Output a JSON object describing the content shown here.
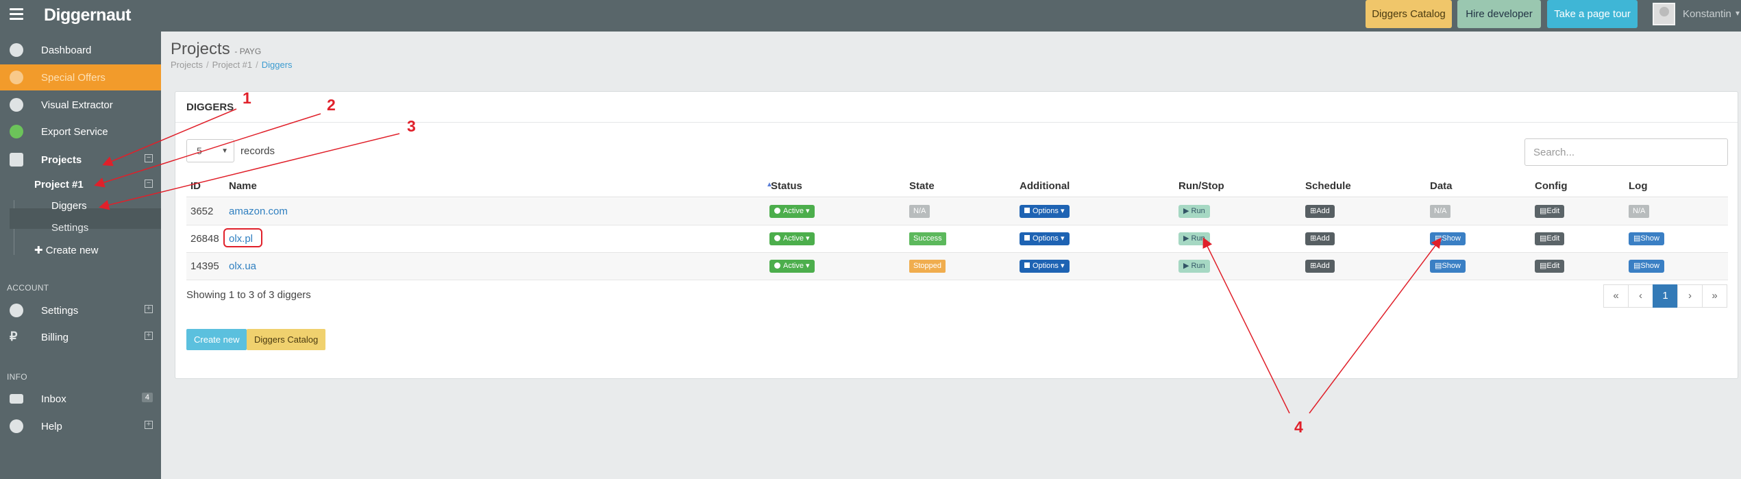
{
  "app": {
    "name": "Diggernaut"
  },
  "topbar": {
    "catalog_label": "Diggers Catalog",
    "hire_label": "Hire developer",
    "tour_label": "Take a page tour",
    "user_name": "Konstantin"
  },
  "sidebar": {
    "items": [
      {
        "label": "Dashboard",
        "icon": "dashboard-icon"
      },
      {
        "label": "Special Offers",
        "icon": "diamond-icon"
      },
      {
        "label": "Visual Extractor",
        "icon": "chrome-icon"
      },
      {
        "label": "Export Service",
        "icon": "cloud-upload-icon"
      },
      {
        "label": "Projects",
        "icon": "briefcase-icon"
      }
    ],
    "project": "Project #1",
    "sub_diggers": "Diggers",
    "sub_settings": "Settings",
    "create_new": "Create new",
    "account_header": "ACCOUNT",
    "account_items": [
      {
        "label": "Settings",
        "icon": "gears-icon"
      },
      {
        "label": "Billing",
        "icon": "ruble-icon"
      }
    ],
    "info_header": "INFO",
    "info_items": [
      {
        "label": "Inbox",
        "icon": "inbox-icon",
        "badge": "4"
      },
      {
        "label": "Help",
        "icon": "question-icon"
      }
    ]
  },
  "header": {
    "title": "Projects",
    "subtitle": "- PAYG",
    "breadcrumb": [
      "Projects",
      "Project #1",
      "Diggers"
    ]
  },
  "panel": {
    "title": "DIGGERS",
    "records_value": "5",
    "records_label": "records",
    "search_placeholder": "Search..."
  },
  "table": {
    "columns": [
      "ID",
      "Name",
      "Status",
      "State",
      "Additional",
      "Run/Stop",
      "Schedule",
      "Data",
      "Config",
      "Log"
    ],
    "rows": [
      {
        "id": "3652",
        "name": "amazon.com",
        "status": "Active",
        "state": "N/A",
        "additional": "Options",
        "run": "Run",
        "schedule": "Add",
        "data": "N/A",
        "config": "Edit",
        "log": "N/A"
      },
      {
        "id": "26848",
        "name": "olx.pl",
        "status": "Active",
        "state": "Success",
        "additional": "Options",
        "run": "Run",
        "schedule": "Add",
        "data": "Show",
        "config": "Edit",
        "log": "Show"
      },
      {
        "id": "14395",
        "name": "olx.ua",
        "status": "Active",
        "state": "Stopped",
        "additional": "Options",
        "run": "Run",
        "schedule": "Add",
        "data": "Show",
        "config": "Edit",
        "log": "Show"
      }
    ]
  },
  "footer": {
    "showing": "Showing 1 to 3 of 3 diggers",
    "pager": [
      "«",
      "‹",
      "1",
      "›",
      "»"
    ],
    "create_label": "Create new",
    "catalog_label": "Diggers Catalog"
  },
  "annotations": {
    "labels": [
      "1",
      "2",
      "3",
      "4"
    ],
    "color": "#e0202a"
  },
  "colors": {
    "sidebar": "#59666a",
    "special_offers": "#f29b2b",
    "primary": "#337ab7"
  }
}
